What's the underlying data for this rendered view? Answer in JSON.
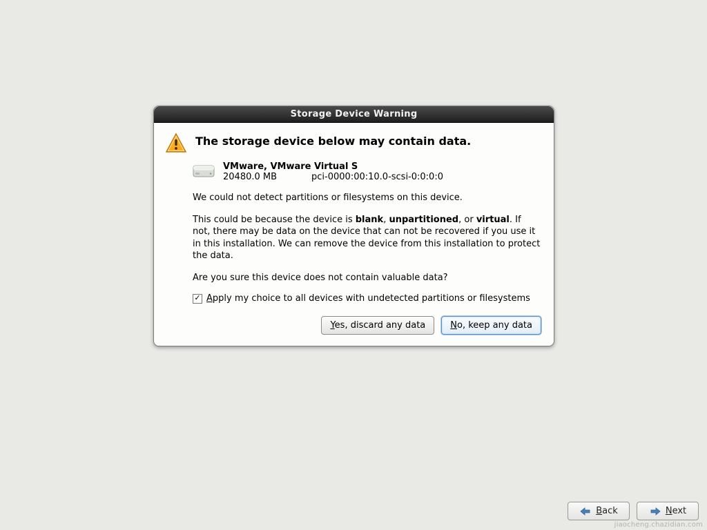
{
  "dialog": {
    "title": "Storage Device Warning",
    "header": "The storage device below may contain data.",
    "device": {
      "name": "VMware, VMware Virtual S",
      "size": "20480.0 MB",
      "path": "pci-0000:00:10.0-scsi-0:0:0:0"
    },
    "para1": "We could not detect partitions or filesystems on this device.",
    "para2_pre": "This could be because the device is ",
    "para2_b1": "blank",
    "para2_sep1": ", ",
    "para2_b2": "unpartitioned",
    "para2_sep2": ", or ",
    "para2_b3": "virtual",
    "para2_post": ". If not, there may be data on the device that can not be recovered if you use it in this installation. We can remove the device from this installation to protect the data.",
    "para3": "Are you sure this device does not contain valuable data?",
    "checkbox_label": "Apply my choice to all devices with undetected partitions or filesystems",
    "checkbox_checked": true,
    "btn_yes_u": "Y",
    "btn_yes_rest": "es, discard any data",
    "btn_no_u": "N",
    "btn_no_rest": "o, keep any data"
  },
  "nav": {
    "back_u": "B",
    "back_rest": "ack",
    "next_u": "N",
    "next_rest": "ext"
  },
  "watermark": "jiaocheng.chazidian.com"
}
